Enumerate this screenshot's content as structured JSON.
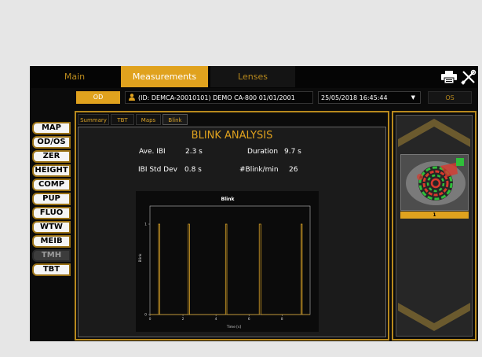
{
  "tabs": {
    "main": "Main",
    "measurements": "Measurements",
    "lenses": "Lenses"
  },
  "eye": {
    "od": "OD",
    "os": "OS"
  },
  "patient": "(ID: DEMCA-20010101) DEMO CA-800 01/01/2001",
  "exam_date": "25/05/2018 16:45:44",
  "menu": [
    {
      "label": "MAP",
      "enabled": true
    },
    {
      "label": "OD/OS",
      "enabled": true
    },
    {
      "label": "ZER",
      "enabled": true
    },
    {
      "label": "HEIGHT",
      "enabled": true
    },
    {
      "label": "COMP",
      "enabled": true
    },
    {
      "label": "PUP",
      "enabled": true
    },
    {
      "label": "FLUO",
      "enabled": true
    },
    {
      "label": "WTW",
      "enabled": true
    },
    {
      "label": "MEIB",
      "enabled": true
    },
    {
      "label": "TMH",
      "enabled": false
    },
    {
      "label": "TBT",
      "enabled": true
    }
  ],
  "subtabs": [
    "Summary",
    "TBT",
    "Maps",
    "Blink"
  ],
  "active_subtab": "Blink",
  "analysis": {
    "title": "BLINK ANALYSIS",
    "ave_ibi_label": "Ave. IBI",
    "ave_ibi_value": "2.3 s",
    "ibi_std_label": "IBI Std Dev",
    "ibi_std_value": "0.8 s",
    "duration_label": "Duration",
    "duration_value": "9.7 s",
    "blinks_label": "#Blink/min",
    "blinks_value": "26"
  },
  "thumbnail": {
    "label": "1"
  },
  "colors": {
    "accent": "#e0a21e",
    "background": "#0b0b0b",
    "plot_line": "#d9a227"
  },
  "chart_data": {
    "type": "line",
    "title": "Blink",
    "xlabel": "Time [s]",
    "ylabel": "Blink",
    "xlim": [
      0,
      9.7
    ],
    "ylim": [
      0,
      1.2
    ],
    "xticks": [
      0,
      2,
      4,
      6,
      8
    ],
    "yticks": [
      0,
      1
    ],
    "blinks": [
      {
        "start": 0.52,
        "end": 0.6
      },
      {
        "start": 2.32,
        "end": 2.4
      },
      {
        "start": 4.58,
        "end": 4.66
      },
      {
        "start": 6.62,
        "end": 6.72
      },
      {
        "start": 9.15,
        "end": 9.22
      }
    ]
  }
}
